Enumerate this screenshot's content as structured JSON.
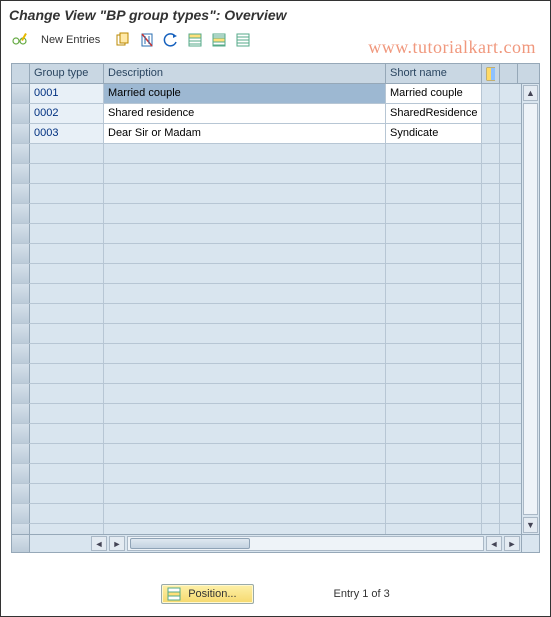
{
  "title": "Change View \"BP group types\": Overview",
  "watermark": "www.tutorialkart.com",
  "toolbar": {
    "new_entries_label": "New Entries"
  },
  "grid": {
    "headers": {
      "group_type": "Group type",
      "description": "Description",
      "short_name": "Short name"
    },
    "rows": [
      {
        "group_type": "0001",
        "description": "Married couple",
        "short_name": "Married couple",
        "selected": true
      },
      {
        "group_type": "0002",
        "description": "Shared residence",
        "short_name": "SharedResidence",
        "selected": false
      },
      {
        "group_type": "0003",
        "description": "Dear Sir or Madam",
        "short_name": "Syndicate",
        "selected": false
      }
    ],
    "empty_rows": 20
  },
  "footer": {
    "position_label": "Position...",
    "entry_counter": "Entry 1 of 3"
  },
  "icons": {
    "toggle": "toggle-icon",
    "copy": "copy-icon",
    "delete": "delete-icon",
    "undo": "undo-icon",
    "select_all": "select-all-icon",
    "select_block": "select-block-icon",
    "deselect": "deselect-icon",
    "config": "config-columns-icon",
    "position": "position-icon"
  }
}
